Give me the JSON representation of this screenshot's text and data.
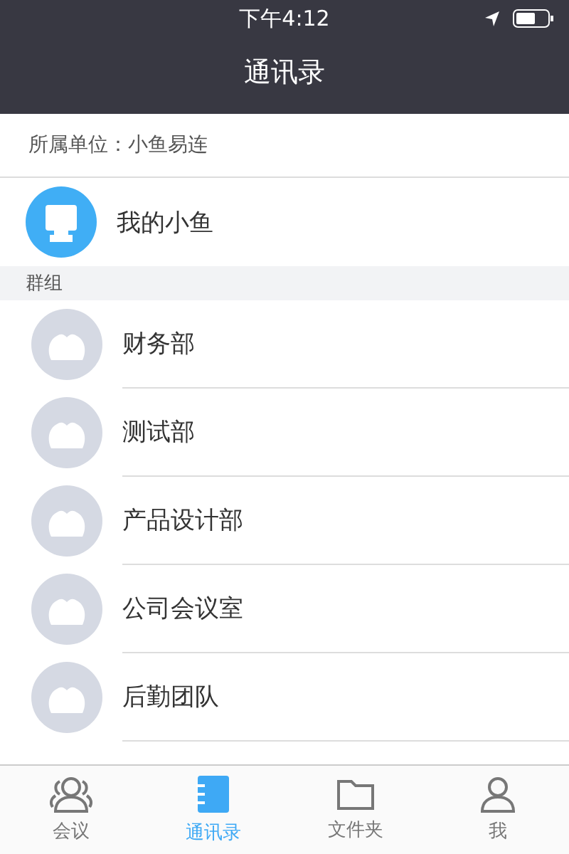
{
  "status_bar": {
    "time": "下午4:12"
  },
  "header": {
    "title": "通讯录"
  },
  "organization": "所属单位：小鱼易连",
  "my_device": {
    "name": "我的小鱼"
  },
  "section": {
    "title": "群组"
  },
  "groups": [
    {
      "name": "财务部"
    },
    {
      "name": "测试部"
    },
    {
      "name": "产品设计部"
    },
    {
      "name": "公司会议室"
    },
    {
      "name": "后勤团队"
    }
  ],
  "tabs": [
    {
      "label": "会议",
      "kind": "people",
      "selected": false
    },
    {
      "label": "通讯录",
      "kind": "book",
      "selected": true
    },
    {
      "label": "文件夹",
      "kind": "folder",
      "selected": false
    },
    {
      "label": "我",
      "kind": "person",
      "selected": false
    }
  ]
}
